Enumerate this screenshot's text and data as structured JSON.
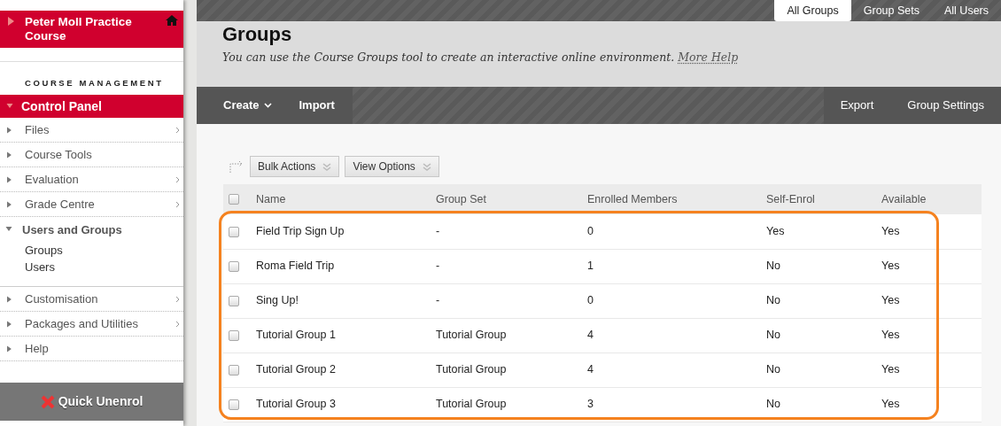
{
  "course": {
    "title": "Peter Moll Practice Course"
  },
  "sidebar": {
    "section_label": "COURSE MANAGEMENT",
    "panel": {
      "label": "Control Panel",
      "expanded": true
    },
    "items": [
      {
        "label": "Files",
        "expanded": false,
        "has_submenu": true
      },
      {
        "label": "Course Tools",
        "expanded": false,
        "has_submenu": false
      },
      {
        "label": "Evaluation",
        "expanded": false,
        "has_submenu": true
      },
      {
        "label": "Grade Centre",
        "expanded": false,
        "has_submenu": true
      },
      {
        "label": "Users and Groups",
        "expanded": true,
        "has_submenu": false,
        "children": [
          {
            "label": "Groups"
          },
          {
            "label": "Users"
          }
        ]
      },
      {
        "label": "Customisation",
        "expanded": false,
        "has_submenu": true
      },
      {
        "label": "Packages and Utilities",
        "expanded": false,
        "has_submenu": true
      },
      {
        "label": "Help",
        "expanded": false,
        "has_submenu": false
      }
    ],
    "footer_button": "Quick Unenrol"
  },
  "tabs": [
    {
      "label": "All Groups",
      "selected": true
    },
    {
      "label": "Group Sets",
      "selected": false
    },
    {
      "label": "All Users",
      "selected": false
    }
  ],
  "page": {
    "title": "Groups",
    "description": "You can use the Course Groups tool to create an interactive online environment.",
    "help_link": "More Help"
  },
  "action_bar": {
    "left": [
      {
        "label": "Create",
        "dropdown": true
      },
      {
        "label": "Import",
        "dropdown": false
      }
    ],
    "right": [
      "Export",
      "Group Settings"
    ]
  },
  "list_buttons": [
    "Bulk Actions",
    "View Options"
  ],
  "table": {
    "select_all_checked": false,
    "columns": [
      "Name",
      "Group Set",
      "Enrolled Members",
      "Self-Enrol",
      "Available"
    ],
    "rows": [
      {
        "cells": [
          "Field Trip Sign Up",
          "-",
          "0",
          "Yes",
          "Yes"
        ],
        "checked": false
      },
      {
        "cells": [
          "Roma Field Trip",
          "-",
          "1",
          "No",
          "Yes"
        ],
        "checked": false
      },
      {
        "cells": [
          "Sing Up!",
          "-",
          "0",
          "No",
          "Yes"
        ],
        "checked": false
      },
      {
        "cells": [
          "Tutorial Group 1",
          "Tutorial Group",
          "4",
          "No",
          "Yes"
        ],
        "checked": false
      },
      {
        "cells": [
          "Tutorial Group 2",
          "Tutorial Group",
          "4",
          "No",
          "Yes"
        ],
        "checked": false
      },
      {
        "cells": [
          "Tutorial Group 3",
          "Tutorial Group",
          "3",
          "No",
          "Yes"
        ],
        "checked": false
      }
    ]
  }
}
